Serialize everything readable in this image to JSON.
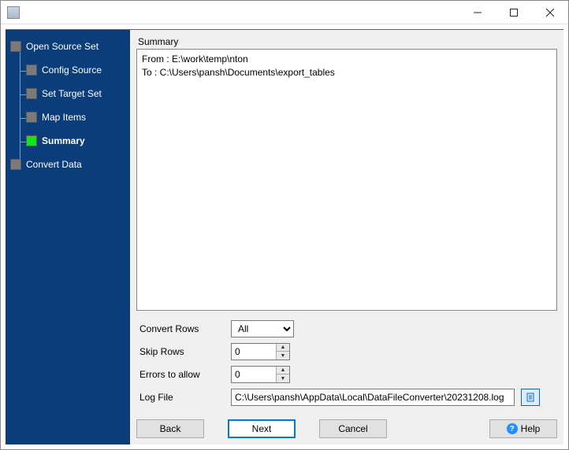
{
  "window": {
    "title": ""
  },
  "nav": {
    "items": [
      {
        "label": "Open Source Set"
      },
      {
        "label": "Config Source"
      },
      {
        "label": "Set Target Set"
      },
      {
        "label": "Map Items"
      },
      {
        "label": "Summary"
      },
      {
        "label": "Convert Data"
      }
    ]
  },
  "summary": {
    "heading": "Summary",
    "from_line": "From : E:\\work\\temp\\nton",
    "to_line": "To : C:\\Users\\pansh\\Documents\\export_tables"
  },
  "form": {
    "convert_rows": {
      "label": "Convert Rows",
      "value": "All"
    },
    "skip_rows": {
      "label": "Skip Rows",
      "value": "0"
    },
    "errors": {
      "label": "Errors to allow",
      "value": "0"
    },
    "log_file": {
      "label": "Log File",
      "value": "C:\\Users\\pansh\\AppData\\Local\\DataFileConverter\\20231208.log"
    }
  },
  "buttons": {
    "back": "Back",
    "next": "Next",
    "cancel": "Cancel",
    "help": "Help"
  }
}
